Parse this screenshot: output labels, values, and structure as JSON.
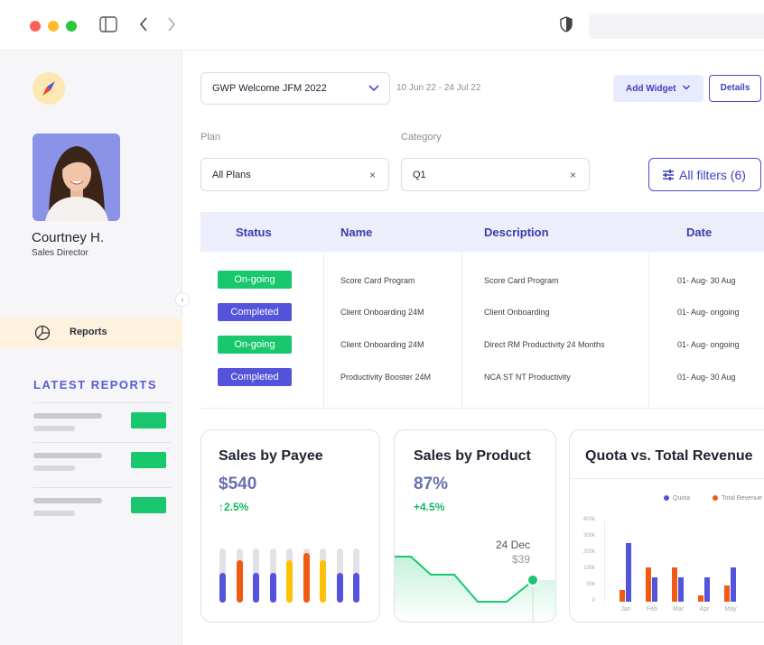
{
  "window": {
    "nav_back": "‹",
    "nav_forward": "›"
  },
  "sidebar": {
    "user_name": "Courtney H.",
    "user_role": "Sales Director",
    "nav_reports": "Reports",
    "latest_reports_heading": "LATEST REPORTS",
    "collapse_glyph": "‹"
  },
  "toolbar": {
    "welcome_select": "GWP Welcome JFM 2022",
    "date_range": "10 Jun 22 - 24 Jul 22",
    "add_widget": "Add Widget",
    "details": "Details"
  },
  "filters": {
    "plan_label": "Plan",
    "plan_value": "All Plans",
    "category_label": "Category",
    "category_value": "Q1",
    "clear_glyph": "×",
    "all_filters": "All filters (6)"
  },
  "table": {
    "headers": {
      "status": "Status",
      "name": "Name",
      "description": "Description",
      "date": "Date"
    },
    "rows": [
      {
        "status": "On-going",
        "name": "Score Card Program",
        "description": "Score Card Program",
        "date": "01- Aug- 30 Aug"
      },
      {
        "status": "Completed",
        "name": "Client Onboarding 24M",
        "description": "Client Onboarding",
        "date": "01- Aug- ongoing"
      },
      {
        "status": "On-going",
        "name": "Client Onboarding 24M",
        "description": "Direct RM Productivity 24 Months",
        "date": "01- Aug- ongoing"
      },
      {
        "status": "Completed",
        "name": "Productivity Booster 24M",
        "description": "NCA ST NT Productivity",
        "date": "01- Aug- 30 Aug"
      }
    ]
  },
  "cards": {
    "payee": {
      "title": "Sales by Payee",
      "value": "$540",
      "change": "↑2.5%",
      "bars": [
        {
          "level": 0.55,
          "color": "#5353db"
        },
        {
          "level": 0.78,
          "color": "#f05a12"
        },
        {
          "level": 0.55,
          "color": "#5353db"
        },
        {
          "level": 0.55,
          "color": "#5353db"
        },
        {
          "level": 0.78,
          "color": "#ffc107"
        },
        {
          "level": 0.92,
          "color": "#f05a12"
        },
        {
          "level": 0.78,
          "color": "#ffc107"
        },
        {
          "level": 0.55,
          "color": "#5353db"
        },
        {
          "level": 0.55,
          "color": "#5353db"
        }
      ]
    },
    "product": {
      "title": "Sales by Product",
      "value": "87%",
      "change": "+4.5%",
      "tooltip_date": "24 Dec",
      "tooltip_value": "$39"
    },
    "quota": {
      "title": "Quota vs. Total Revenue",
      "colors": {
        "quota": "#5353db",
        "revenue": "#f05a12"
      }
    }
  },
  "chart_data": {
    "type": "bar",
    "title": "Quota vs. Total Revenue",
    "legend": [
      "Quota",
      "Total Revenue"
    ],
    "legend_position": "top-right",
    "categories": [
      "Jan",
      "Feb",
      "Mar",
      "Apr",
      "May"
    ],
    "y_ticks": [
      "400k",
      "300k",
      "200k",
      "100k",
      "50k",
      "0"
    ],
    "ylim": [
      0,
      400000
    ],
    "series": [
      {
        "name": "Quota",
        "values": [
          290000,
          120000,
          120000,
          120000,
          170000
        ]
      },
      {
        "name": "Total Revenue",
        "values": [
          60000,
          170000,
          170000,
          30000,
          80000
        ]
      }
    ]
  }
}
